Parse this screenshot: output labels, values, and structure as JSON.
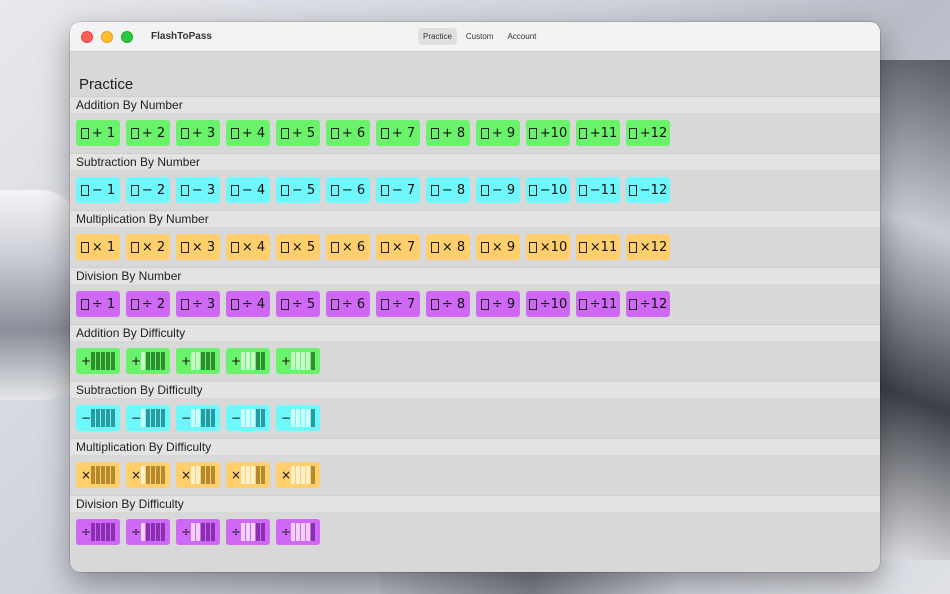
{
  "window": {
    "title": "FlashToPass"
  },
  "tabs": [
    {
      "label": "Practice",
      "active": true
    },
    {
      "label": "Custom",
      "active": false
    },
    {
      "label": "Account",
      "active": false
    }
  ],
  "page_title": "Practice",
  "sections": [
    {
      "title": "Addition By Number",
      "color": "#6af36a",
      "kind": "number",
      "items": [
        "+ 1",
        "+ 2",
        "+ 3",
        "+ 4",
        "+ 5",
        "+ 6",
        "+ 7",
        "+ 8",
        "+ 9",
        "+10",
        "+11",
        "+12"
      ]
    },
    {
      "title": "Subtraction By Number",
      "color": "#6ff8fb",
      "kind": "number",
      "items": [
        "− 1",
        "− 2",
        "− 3",
        "− 4",
        "− 5",
        "− 6",
        "− 7",
        "− 8",
        "− 9",
        "−10",
        "−11",
        "−12"
      ]
    },
    {
      "title": "Multiplication By Number",
      "color": "#ffcf6e",
      "kind": "number",
      "items": [
        "× 1",
        "× 2",
        "× 3",
        "× 4",
        "× 5",
        "× 6",
        "× 7",
        "× 8",
        "× 9",
        "×10",
        "×11",
        "×12"
      ]
    },
    {
      "title": "Division By Number",
      "color": "#cf68f5",
      "kind": "number",
      "items": [
        "÷ 1",
        "÷ 2",
        "÷ 3",
        "÷ 4",
        "÷ 5",
        "÷ 6",
        "÷ 7",
        "÷ 8",
        "÷ 9",
        "÷10",
        "÷11",
        "÷12"
      ]
    },
    {
      "title": "Addition By Difficulty",
      "color": "#6af36a",
      "kind": "difficulty",
      "op": "+",
      "levels": [
        1,
        2,
        3,
        4,
        5
      ]
    },
    {
      "title": "Subtraction By Difficulty",
      "color": "#6ff8fb",
      "kind": "difficulty",
      "op": "−",
      "levels": [
        1,
        2,
        3,
        4,
        5
      ]
    },
    {
      "title": "Multiplication By Difficulty",
      "color": "#ffcf6e",
      "kind": "difficulty",
      "op": "×",
      "levels": [
        1,
        2,
        3,
        4,
        5
      ]
    },
    {
      "title": "Division By Difficulty",
      "color": "#cf68f5",
      "kind": "difficulty",
      "op": "÷",
      "levels": [
        1,
        2,
        3,
        4,
        5
      ]
    }
  ]
}
